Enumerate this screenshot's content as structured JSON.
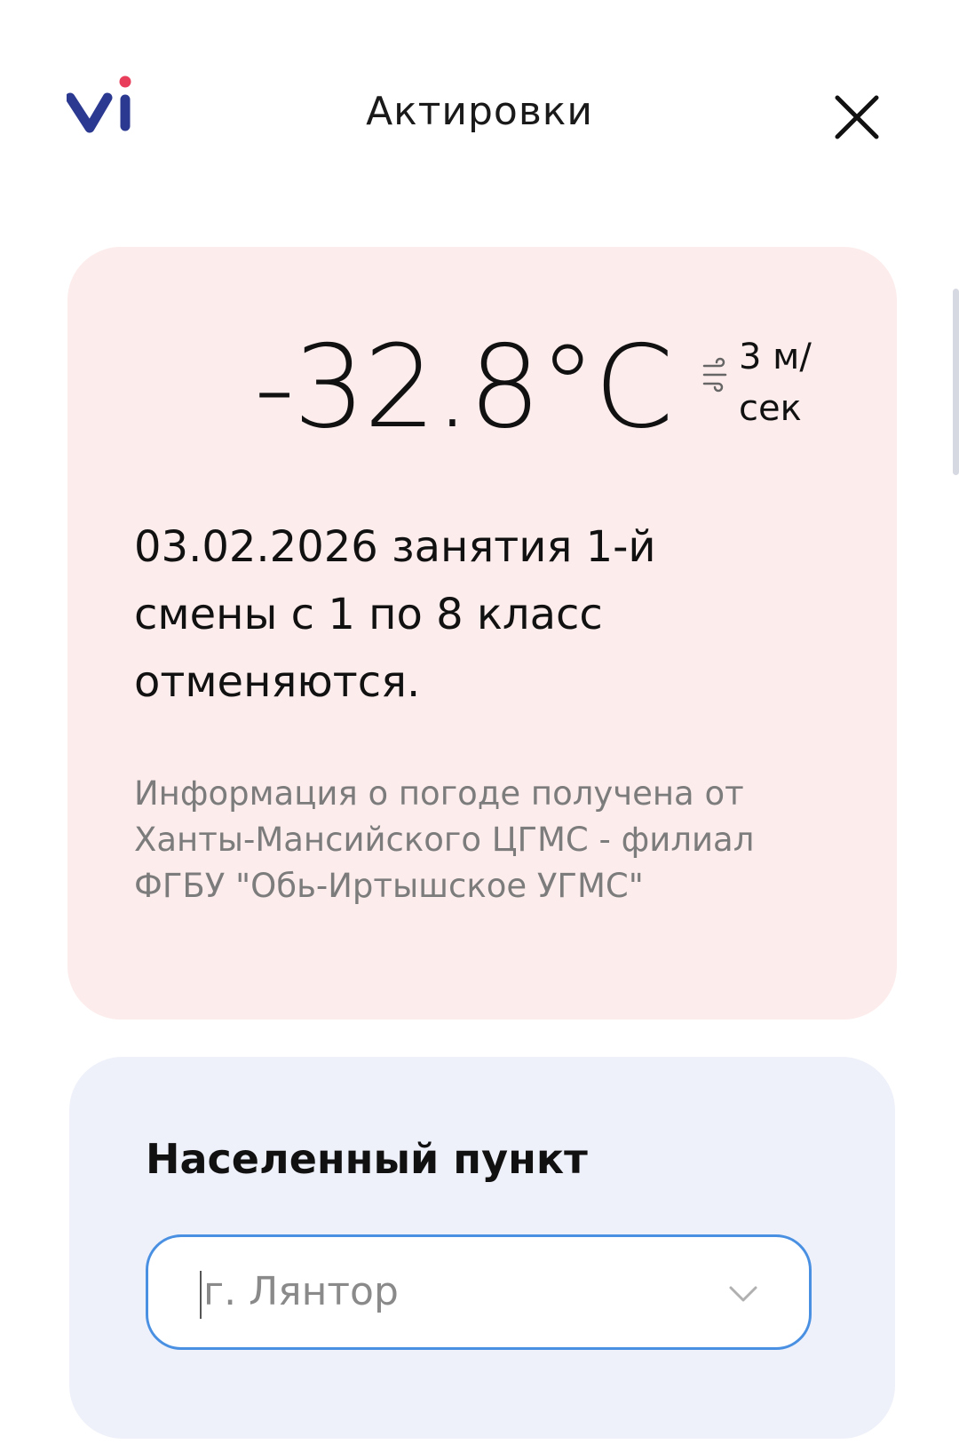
{
  "header": {
    "title": "Актировки",
    "logo_icon": "vi-logo-icon",
    "close_icon": "close-icon"
  },
  "alert": {
    "temperature": "-32.8°C",
    "wind_icon": "wind-icon",
    "wind_speed": "3 м/сек",
    "notice": "03.02.2026 занятия 1-й смены с 1 по 8 класс отменяются.",
    "source": "Информация о погоде получена от Ханты-Мансийского ЦГМС - филиал ФГБУ \"Обь-Иртышское УГМС\""
  },
  "location": {
    "label": "Населенный пункт",
    "selected_value": "г. Лянтор",
    "chevron_icon": "chevron-down-icon"
  },
  "colors": {
    "alert_bg": "#fdecec",
    "location_bg": "#eff1fa",
    "logo_blue": "#2b3990",
    "logo_dot": "#e83e5c",
    "select_border": "#4a90e2"
  }
}
